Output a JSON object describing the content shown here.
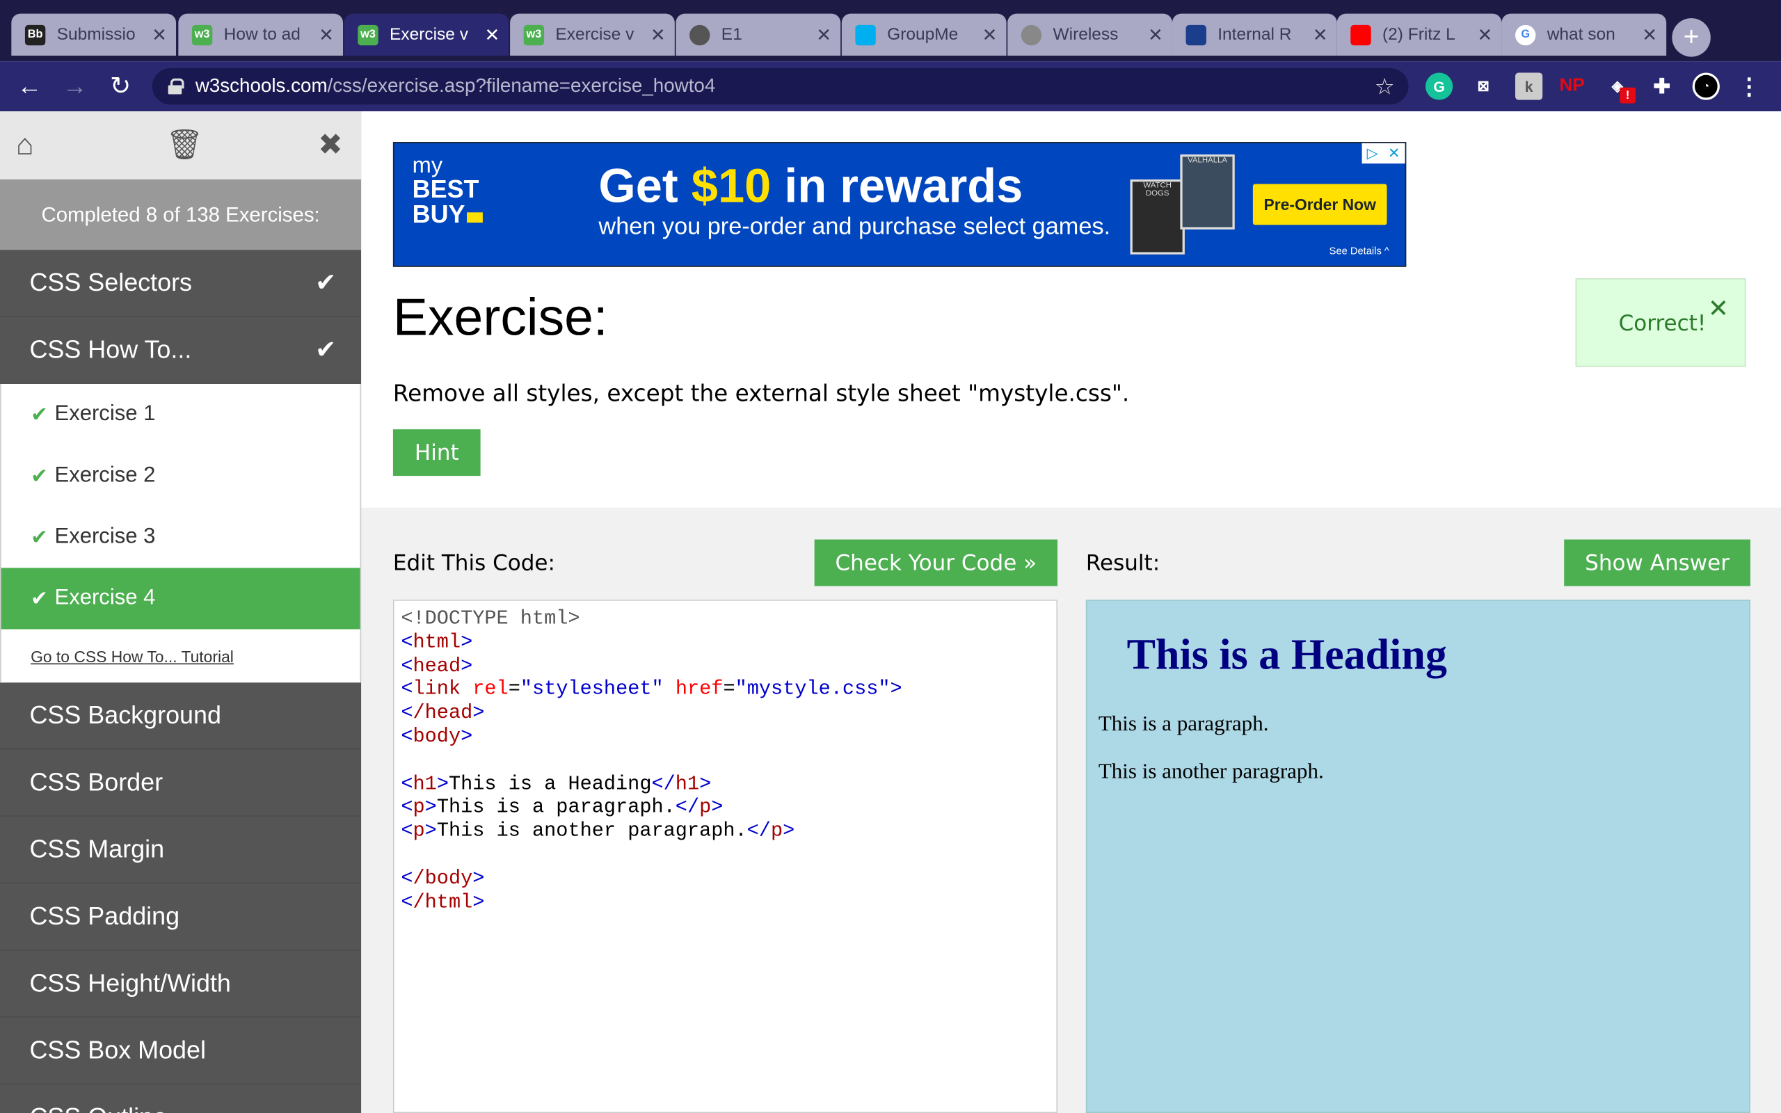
{
  "browser": {
    "tabs": [
      {
        "title": "Submissio",
        "favicon": "Bb",
        "active": false
      },
      {
        "title": "How to ad",
        "favicon": "w3",
        "active": false
      },
      {
        "title": "Exercise v",
        "favicon": "w3",
        "active": true
      },
      {
        "title": "Exercise v",
        "favicon": "w3",
        "active": false
      },
      {
        "title": "E1",
        "favicon": "globe",
        "active": false
      },
      {
        "title": "GroupMe",
        "favicon": "groupme",
        "active": false
      },
      {
        "title": "Wireless",
        "favicon": "apple",
        "active": false
      },
      {
        "title": "Internal R",
        "favicon": "internal",
        "active": false
      },
      {
        "title": "(2) Fritz L",
        "favicon": "youtube",
        "active": false
      },
      {
        "title": "what son",
        "favicon": "G",
        "active": false
      }
    ],
    "close_glyph": "✕",
    "new_tab_glyph": "+",
    "url_host": "w3schools.com",
    "url_path": "/css/exercise.asp?filename=exercise_howto4",
    "extensions": [
      "grammarly-icon",
      "readwise-icon",
      "extension-k-icon",
      "np-icon",
      "shield-icon",
      "puzzle-icon",
      "profile-icon"
    ],
    "ext_labels": {
      "np": "NP",
      "k": "k",
      "badge": "!"
    }
  },
  "sidebar": {
    "progress": "Completed 8 of 138 Exercises:",
    "categories_top": [
      {
        "label": "CSS Selectors",
        "done": true
      },
      {
        "label": "CSS How To...",
        "done": true
      }
    ],
    "sub_items": [
      {
        "label": "Exercise 1",
        "active": false
      },
      {
        "label": "Exercise 2",
        "active": false
      },
      {
        "label": "Exercise 3",
        "active": false
      },
      {
        "label": "Exercise 4",
        "active": true
      }
    ],
    "tutorial_link": "Go to CSS How To... Tutorial",
    "categories_bottom": [
      "CSS Background",
      "CSS Border",
      "CSS Margin",
      "CSS Padding",
      "CSS Height/Width",
      "CSS Box Model",
      "CSS Outline"
    ]
  },
  "ad": {
    "logo_my": "my",
    "logo_best": "BEST",
    "logo_buy": "BUY",
    "headline_pre": "Get ",
    "headline_amount": "$10",
    "headline_post": " in rewards",
    "subline": "when you pre-order and purchase select games.",
    "game1": "WATCH DOGS",
    "game2": "VALHALLA",
    "cta": "Pre-Order Now",
    "details": "See Details ^"
  },
  "exercise": {
    "title": "Exercise:",
    "description": "Remove all styles, except the external style sheet \"mystyle.css\".",
    "hint_label": "Hint",
    "correct_label": "Correct!",
    "correct_close": "✕"
  },
  "editor": {
    "label": "Edit This Code:",
    "check_label": "Check Your Code »",
    "code": {
      "doctype": "<!DOCTYPE html>",
      "html_open": "html",
      "head_open": "head",
      "link_tag": "link",
      "rel_attr": "rel",
      "rel_val": "\"stylesheet\"",
      "href_attr": "href",
      "href_val": "\"mystyle.css\"",
      "head_close": "/head",
      "body_open": "body",
      "h1": "h1",
      "h1_text": "This is a Heading",
      "p": "p",
      "p1_text": "This is a paragraph.",
      "p2_text": "This is another paragraph.",
      "body_close": "/body",
      "html_close": "/html"
    }
  },
  "result": {
    "label": "Result:",
    "show_answer_label": "Show Answer",
    "heading": "This is a Heading",
    "para1": "This is a paragraph.",
    "para2": "This is another paragraph."
  },
  "colors": {
    "accent_green": "#4CAF50",
    "sidebar_bg": "#555555",
    "result_bg": "#add8e6",
    "chrome_bg": "#1d1b45"
  }
}
